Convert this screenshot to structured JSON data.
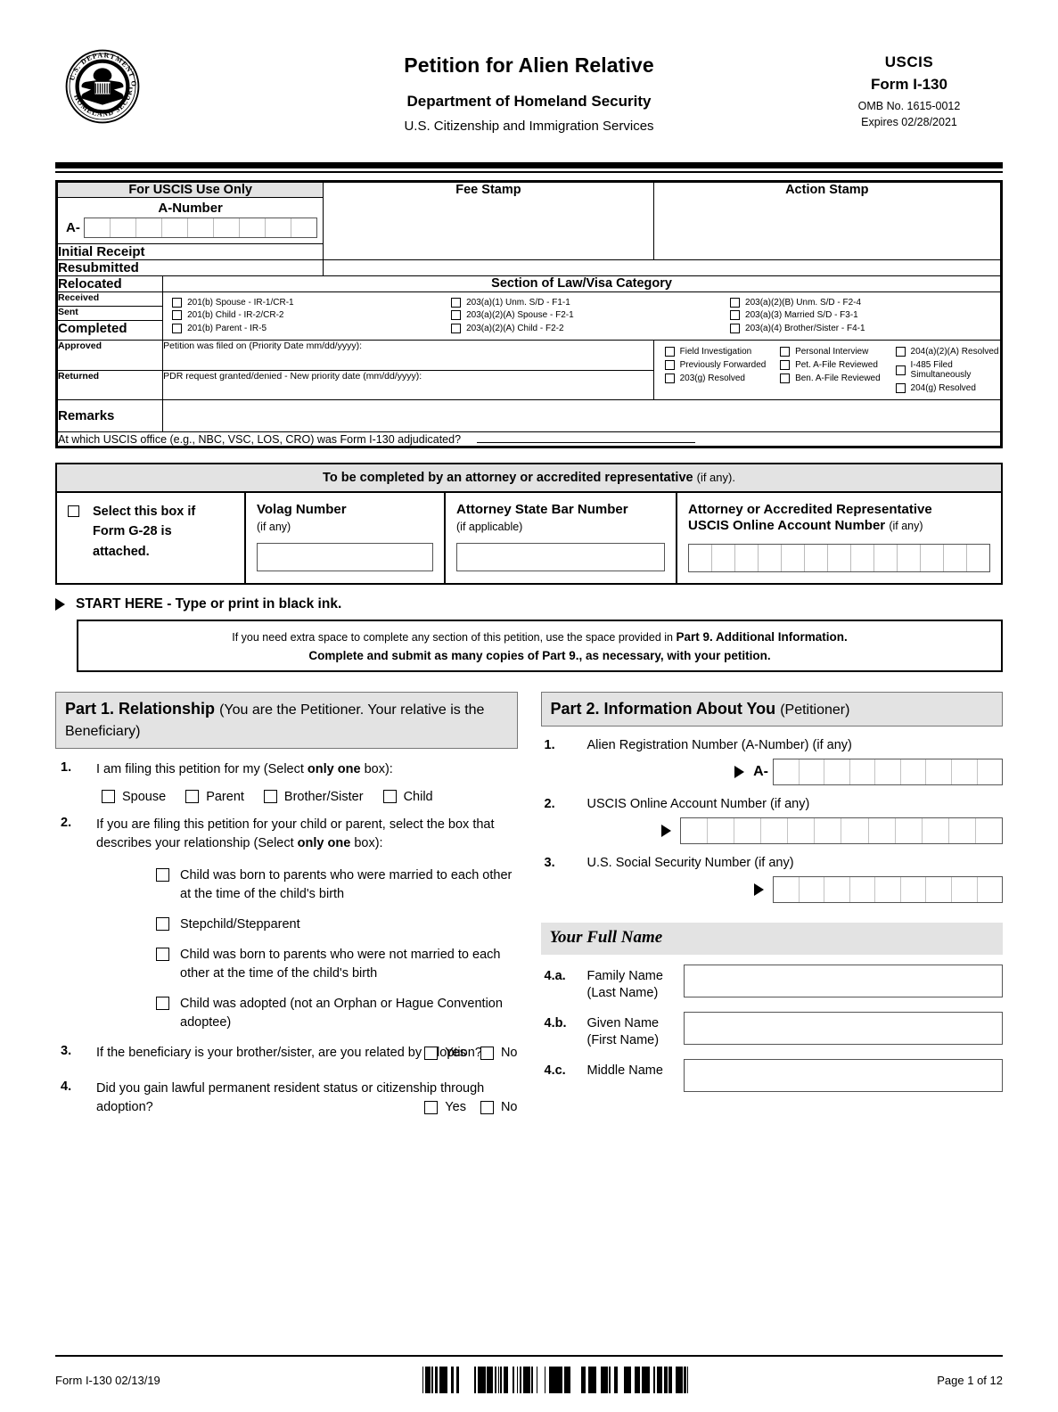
{
  "header": {
    "seal_alt": "dhs-seal",
    "title": "Petition for Alien Relative",
    "department": "Department of Homeland Security",
    "agency": "U.S. Citizenship and Immigration Services",
    "agency_short": "USCIS",
    "form_number": "Form I-130",
    "omb": "OMB No. 1615-0012",
    "expires": "Expires 02/28/2021"
  },
  "uscis_box": {
    "use_only_title": "For USCIS Use Only",
    "fee_stamp": "Fee Stamp",
    "action_stamp": "Action Stamp",
    "a_number_label": "A-Number",
    "a_prefix": "A-",
    "a_cells": 9,
    "rows": [
      "Initial Receipt",
      "Resubmitted",
      "Relocated",
      "Received",
      "Sent",
      "Completed",
      "Approved",
      "Returned",
      "Remarks"
    ],
    "section_title": "Section of Law/Visa Category",
    "law_col1": [
      "201(b) Spouse - IR-1/CR-1",
      "201(b) Child - IR-2/CR-2",
      "201(b) Parent - IR-5"
    ],
    "law_col2": [
      "203(a)(1) Unm. S/D - F1-1",
      "203(a)(2)(A) Spouse - F2-1",
      "203(a)(2)(A) Child - F2-2"
    ],
    "law_col3": [
      "203(a)(2)(B) Unm. S/D - F2-4",
      "203(a)(3) Married S/D - F3-1",
      "203(a)(4) Brother/Sister - F4-1"
    ],
    "approved_text": "Petition was filed on (Priority Date mm/dd/yyyy):",
    "returned_text": "PDR request granted/denied - New priority date (mm/dd/yyyy):",
    "check_col1": [
      "Field Investigation",
      "Previously Forwarded",
      "203(g) Resolved"
    ],
    "check_col2": [
      "Personal Interview",
      "Pet. A-File Reviewed",
      "Ben. A-File Reviewed"
    ],
    "check_col3": [
      "204(a)(2)(A) Resolved",
      "I-485 Filed Simultaneously",
      "204(g) Resolved"
    ],
    "office_question": "At which USCIS office (e.g., NBC, VSC, LOS, CRO) was Form I-130 adjudicated?"
  },
  "attorney": {
    "title": "To be completed by an attorney or accredited representative",
    "title_suffix": "(if any).",
    "g28_line1": "Select this box if",
    "g28_line2": "Form G-28 is",
    "g28_line3": "attached.",
    "volag_label": "Volag Number",
    "volag_note": "(if any)",
    "bar_label": "Attorney State Bar Number",
    "bar_note": "(if applicable)",
    "online_label_1": "Attorney or Accredited Representative",
    "online_label_2": "USCIS Online Account Number",
    "online_note": "(if any)",
    "online_cells": 13
  },
  "start_here": {
    "label": "START HERE - Type or print in black ink.",
    "note_line1_a": "If you need extra space to complete any section of this petition, use the space provided in ",
    "note_line1_b": "Part 9. Additional Information.",
    "note_line2": "Complete and submit as many copies of Part 9., as necessary, with your petition."
  },
  "part1": {
    "heading_bold": "Part 1.  Relationship",
    "heading_reg": "(You are the Petitioner.  Your relative is the Beneficiary)",
    "q1": {
      "num": "1.",
      "text_a": "I am filing this petition for my (Select ",
      "text_b": "only one",
      "text_c": " box):",
      "options": [
        "Spouse",
        "Parent",
        "Brother/Sister",
        "Child"
      ]
    },
    "q2": {
      "num": "2.",
      "text_a": "If you are filing this petition for your child or parent, select the box that describes your relationship (Select ",
      "text_b": "only one",
      "text_c": " box):",
      "items": [
        "Child was born to parents who were married to each other at the time of the child's birth",
        "Stepchild/Stepparent",
        "Child was born to parents who were not married to each other at the time of the child's birth",
        "Child was adopted (not an Orphan or Hague Convention adoptee)"
      ]
    },
    "q3": {
      "num": "3.",
      "text": "If the beneficiary is your brother/sister, are you related by adoption?",
      "yes": "Yes",
      "no": "No"
    },
    "q4": {
      "num": "4.",
      "text": "Did you gain lawful permanent resident status or citizenship through adoption?",
      "yes": "Yes",
      "no": "No"
    }
  },
  "part2": {
    "heading_bold": "Part 2.  Information About You",
    "heading_reg": "(Petitioner)",
    "q1": {
      "num": "1.",
      "label": "Alien Registration Number (A-Number) (if any)",
      "prefix": "A-",
      "cells": 9
    },
    "q2": {
      "num": "2.",
      "label": "USCIS Online Account Number (if any)",
      "cells": 12
    },
    "q3": {
      "num": "3.",
      "label": "U.S. Social Security Number (if any)",
      "cells": 9
    },
    "fullname_heading": "Your Full Name",
    "names": [
      {
        "num": "4.a.",
        "label_1": "Family Name",
        "label_2": "(Last Name)"
      },
      {
        "num": "4.b.",
        "label_1": "Given Name",
        "label_2": "(First Name)"
      },
      {
        "num": "4.c.",
        "label_1": "Middle Name",
        "label_2": ""
      }
    ]
  },
  "footer": {
    "form_rev": "Form I-130  02/13/19",
    "page": "Page 1 of 12"
  }
}
